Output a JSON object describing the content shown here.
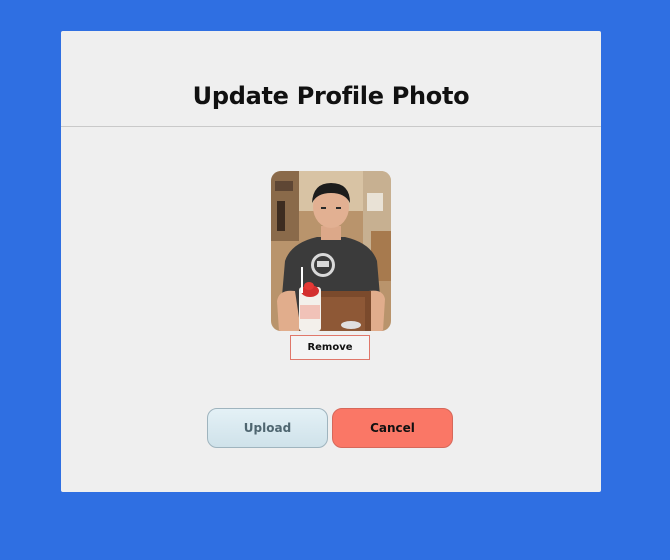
{
  "dialog": {
    "title": "Update Profile Photo",
    "remove_label": "Remove",
    "upload_label": "Upload",
    "cancel_label": "Cancel"
  },
  "colors": {
    "background": "#2f6fe2",
    "dialog_bg": "#efefef",
    "cancel_bg": "#fa7766",
    "upload_bg": "#d8eaf1"
  },
  "icons": {
    "profile_photo": "profile-photo-image"
  }
}
